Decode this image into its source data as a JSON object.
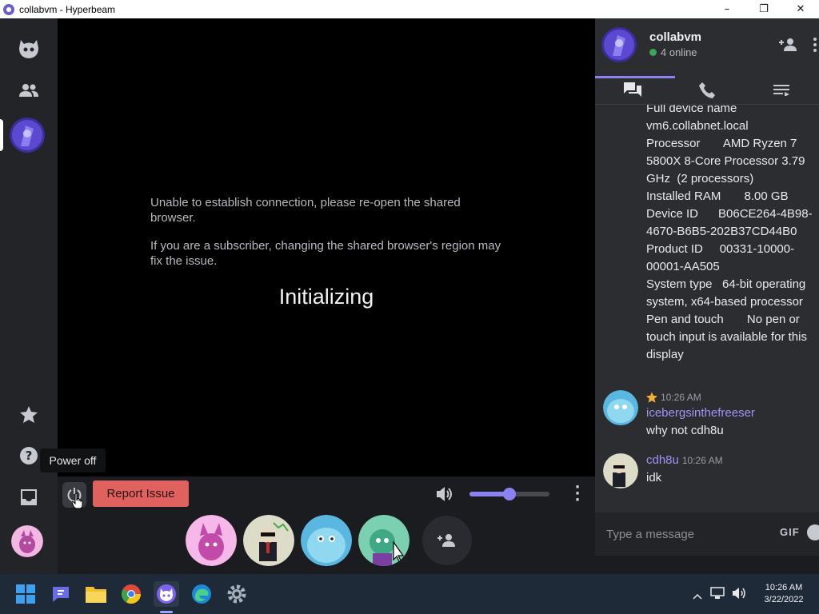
{
  "window": {
    "title": "collabvm - Hyperbeam",
    "minimize": "–",
    "maximize": "❐",
    "close": "✕"
  },
  "stage": {
    "message_1": "Unable to establish connection, please re-open the shared browser.",
    "message_2": "If you are a subscriber, changing the shared browser's region may fix the issue.",
    "status": "Initializing"
  },
  "controls": {
    "tooltip": "Power off",
    "report_label": "Report Issue",
    "volume_level": 0.5,
    "accent": "#8b82f2"
  },
  "chat": {
    "room_name": "collabvm",
    "online_text": "4 online",
    "sysinfo": [
      "Full device name",
      "vm6.collabnet.local",
      "Processor       AMD Ryzen 7 5800X 8-Core Processor 3.79 GHz  (2 processors)",
      "Installed RAM       8.00 GB",
      "Device ID      B06CE264-4B98-4670-B6B5-202B37CD44B0",
      "Product ID     00331-10000-00001-AA505",
      "System type   64-bit operating system, x64-based processor",
      "Pen and touch       No pen or touch input is available for this display"
    ],
    "messages": [
      {
        "time": "10:26 AM",
        "user": "icebergsinthefreeser",
        "text": "why not cdh8u",
        "starred": true
      },
      {
        "time": "10:26 AM",
        "user": "cdh8u",
        "text": "idk",
        "starred": false
      }
    ],
    "input_placeholder": "Type a message",
    "gif_label": "GIF"
  },
  "taskbar": {
    "time": "10:26 AM",
    "date": "3/22/2022"
  }
}
